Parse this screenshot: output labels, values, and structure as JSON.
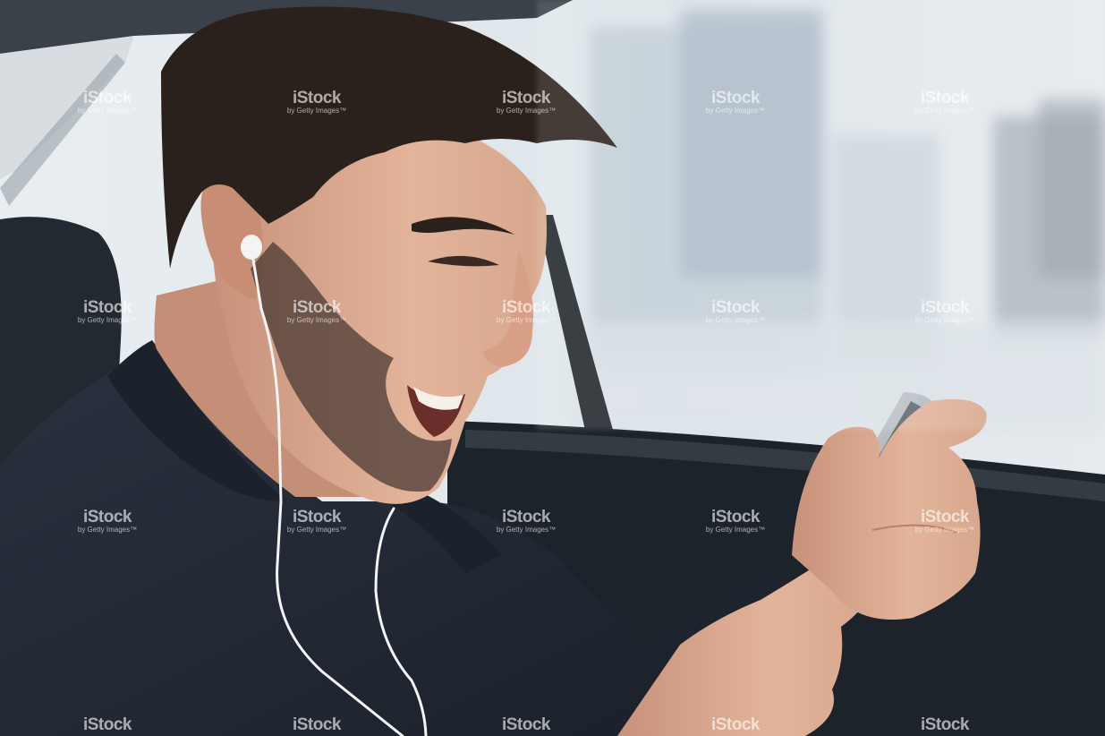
{
  "image": {
    "description_colors": {
      "window_light": "#eef1f3",
      "sky_haze": "#dfe6ea",
      "building_blue": "#a9b8c6",
      "car_interior": "#1f262d",
      "jacket": "#242c38",
      "skin": "#d9a98d",
      "hair": "#2b211c",
      "earphone_cable": "#f4f4f4"
    }
  },
  "watermark": {
    "brand": "iStock",
    "sub": "by Getty Images™"
  }
}
